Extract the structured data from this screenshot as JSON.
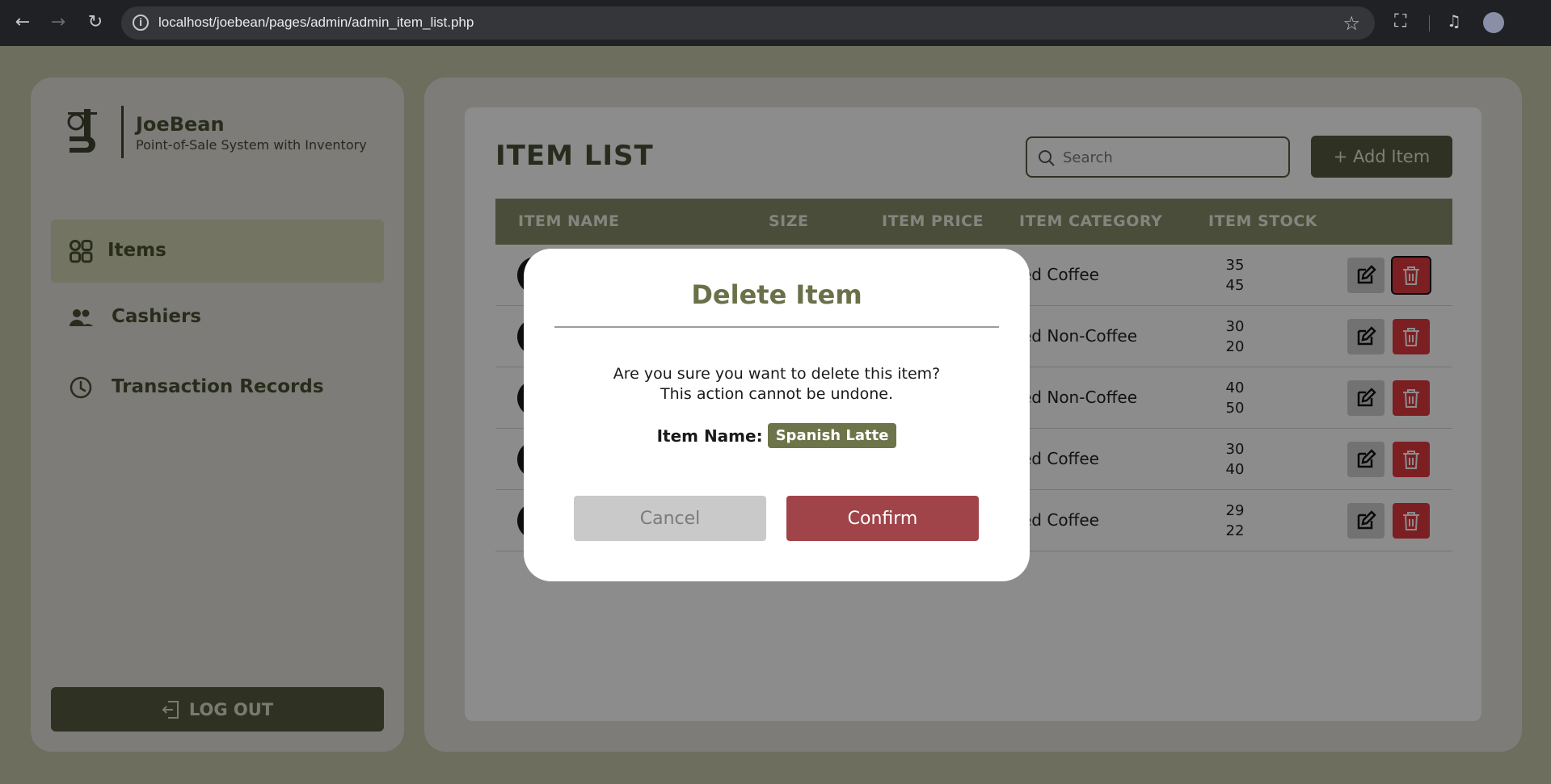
{
  "browser": {
    "url": "localhost/joebean/pages/admin/admin_item_list.php"
  },
  "brand": {
    "name": "JoeBean",
    "subtitle": "Point-of-Sale System with Inventory"
  },
  "sidebar": {
    "items": [
      {
        "label": "Items",
        "icon": "grid-icon",
        "active": true
      },
      {
        "label": "Cashiers",
        "icon": "users-icon",
        "active": false
      },
      {
        "label": "Transaction Records",
        "icon": "clock-icon",
        "active": false
      }
    ],
    "logout_label": "LOG OUT"
  },
  "main": {
    "title": "ITEM LIST",
    "search_placeholder": "Search",
    "add_label": "+ Add Item",
    "columns": [
      "ITEM NAME",
      "SIZE",
      "ITEM PRICE",
      "ITEM CATEGORY",
      "ITEM STOCK"
    ],
    "rows": [
      {
        "category": "ced Coffee",
        "stock": [
          "35",
          "45"
        ]
      },
      {
        "category": "ced Non-Coffee",
        "stock": [
          "30",
          "20"
        ]
      },
      {
        "category": "ced Non-Coffee",
        "stock": [
          "40",
          "50"
        ]
      },
      {
        "category": "ced Coffee",
        "stock": [
          "30",
          "40"
        ]
      },
      {
        "category": "ced Coffee",
        "stock": [
          "29",
          "22"
        ]
      }
    ]
  },
  "modal": {
    "title": "Delete Item",
    "message_line1": "Are you sure you want to delete this item?",
    "message_line2": "This action cannot be undone.",
    "item_label": "Item Name:",
    "item_name": "Spanish Latte",
    "cancel_label": "Cancel",
    "confirm_label": "Confirm"
  },
  "colors": {
    "brand_olive": "#565c3e",
    "danger_red": "#e2393e",
    "confirm_red": "#a0444a"
  }
}
